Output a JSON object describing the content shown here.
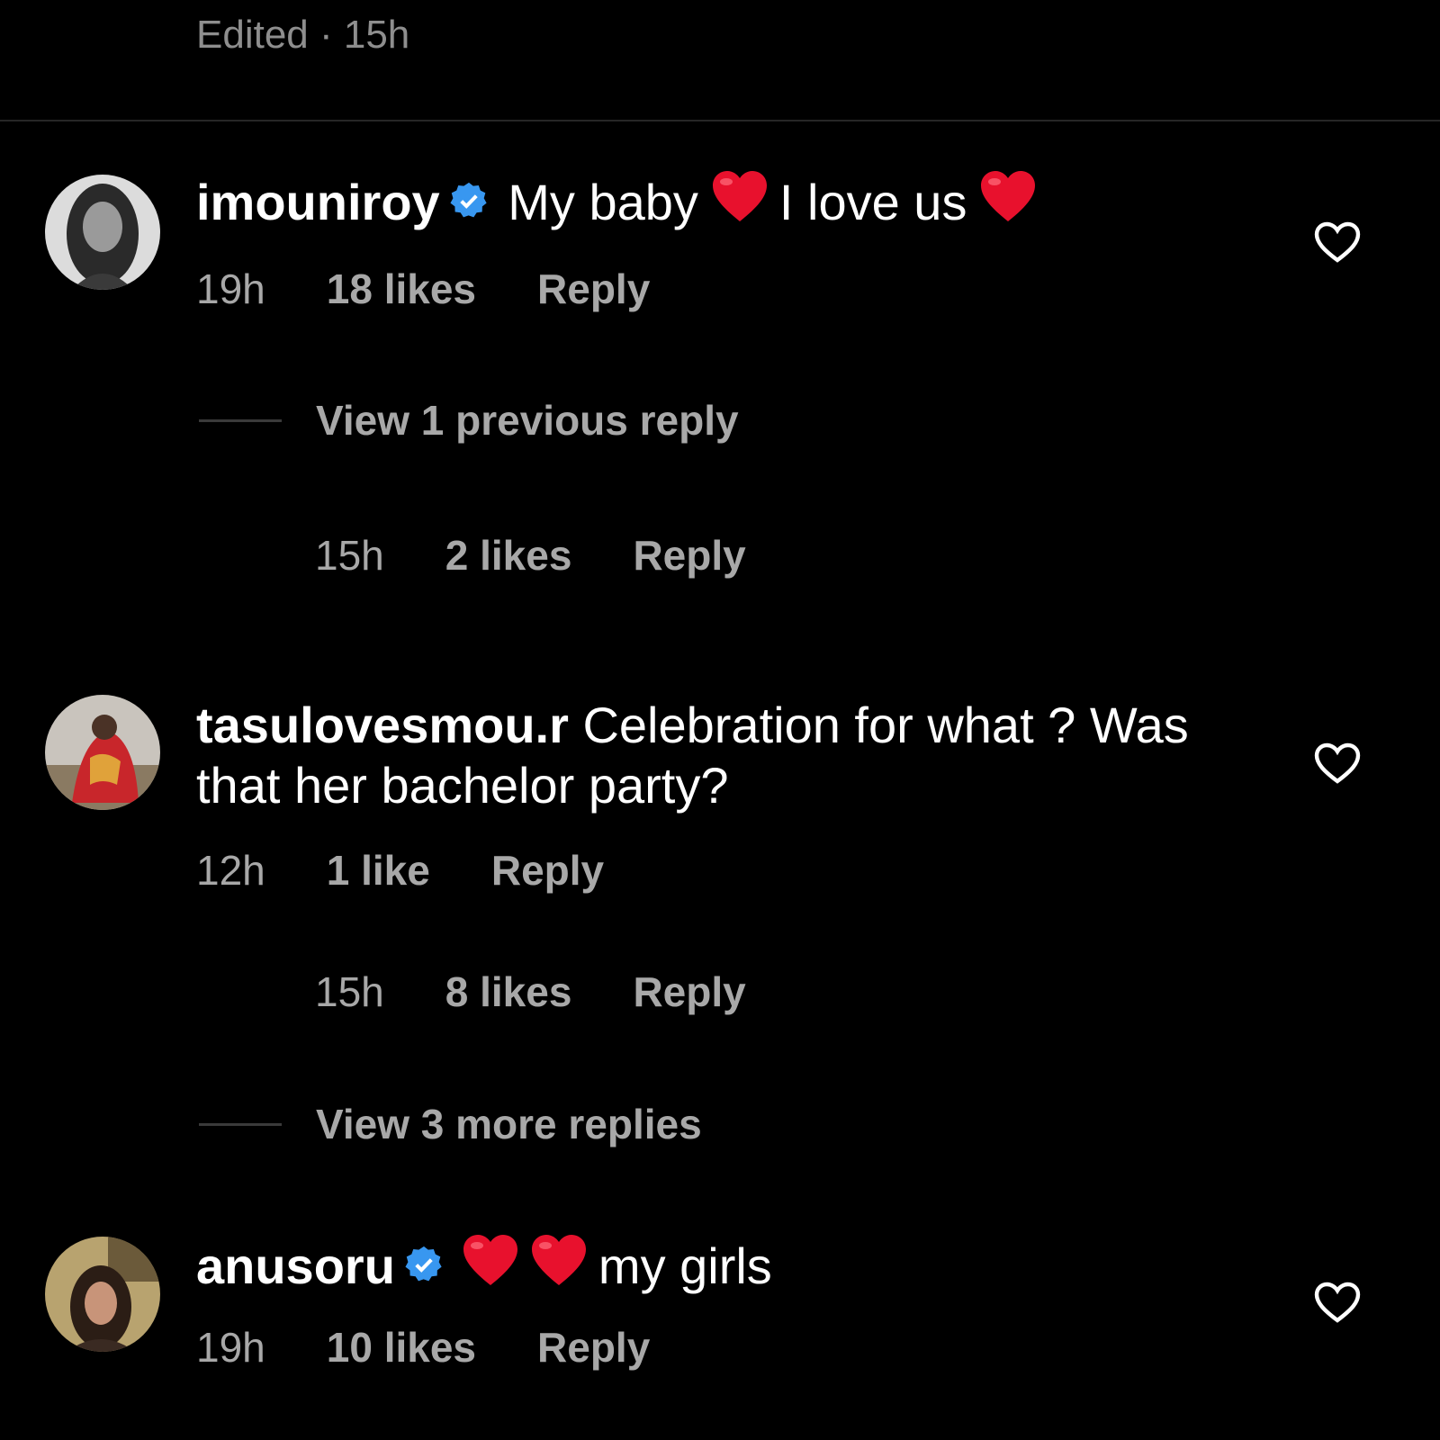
{
  "top": {
    "edited_label": "Edited · 15h"
  },
  "comments": [
    {
      "username": "imouniroy",
      "verified": true,
      "text_before": "My baby",
      "text_middle": "I love us",
      "time": "19h",
      "likes": "18 likes",
      "reply": "Reply",
      "view_replies": "View 1 previous reply",
      "reply_meta": {
        "time": "15h",
        "likes": "2 likes",
        "reply": "Reply"
      }
    },
    {
      "username": "tasulovesmou.r",
      "verified": false,
      "text": "Celebration for what ? Was that her bachelor party?",
      "time": "12h",
      "likes": "1 like",
      "reply": "Reply",
      "reply_meta": {
        "time": "15h",
        "likes": "8 likes",
        "reply": "Reply"
      },
      "view_replies": "View 3 more replies"
    },
    {
      "username": "anusoru",
      "verified": true,
      "text": "my girls",
      "time": "19h",
      "likes": "10 likes",
      "reply": "Reply"
    }
  ],
  "colors": {
    "background": "#000000",
    "muted": "#a8a8a8",
    "verified": "#3897f0",
    "heart_emoji": "#e8112d"
  },
  "icons": {
    "verified": "verified-badge-icon",
    "heart_emoji": "red-heart-emoji-icon",
    "like": "heart-outline-icon"
  }
}
